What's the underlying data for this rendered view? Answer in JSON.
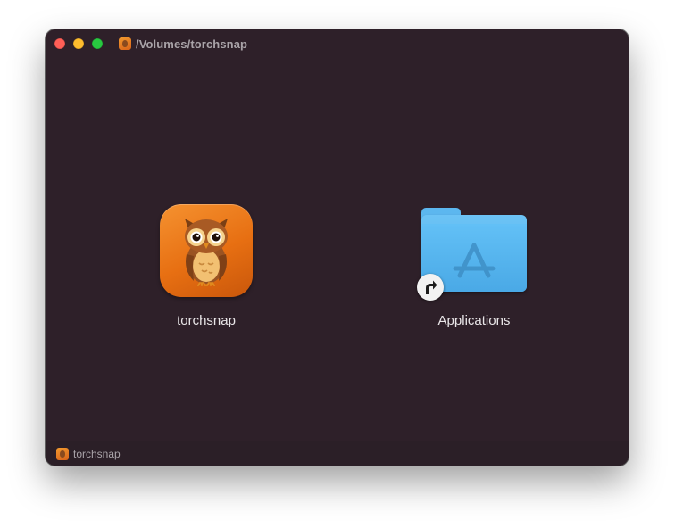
{
  "window": {
    "title": "/Volumes/torchsnap",
    "title_icon": "disk-image-icon"
  },
  "items": [
    {
      "label": "torchsnap",
      "icon": "owl-app-icon",
      "kind": "application"
    },
    {
      "label": "Applications",
      "icon": "applications-folder-icon",
      "kind": "alias",
      "badge_icon": "alias-arrow-icon"
    }
  ],
  "statusbar": {
    "path_label": "torchsnap",
    "path_icon": "disk-image-icon"
  },
  "colors": {
    "window_bg": "#2e2029",
    "app_icon_orange": "#e76f12",
    "folder_blue": "#52b0ec",
    "close": "#ff5f57",
    "minimize": "#febc2e",
    "zoom": "#28c840"
  }
}
